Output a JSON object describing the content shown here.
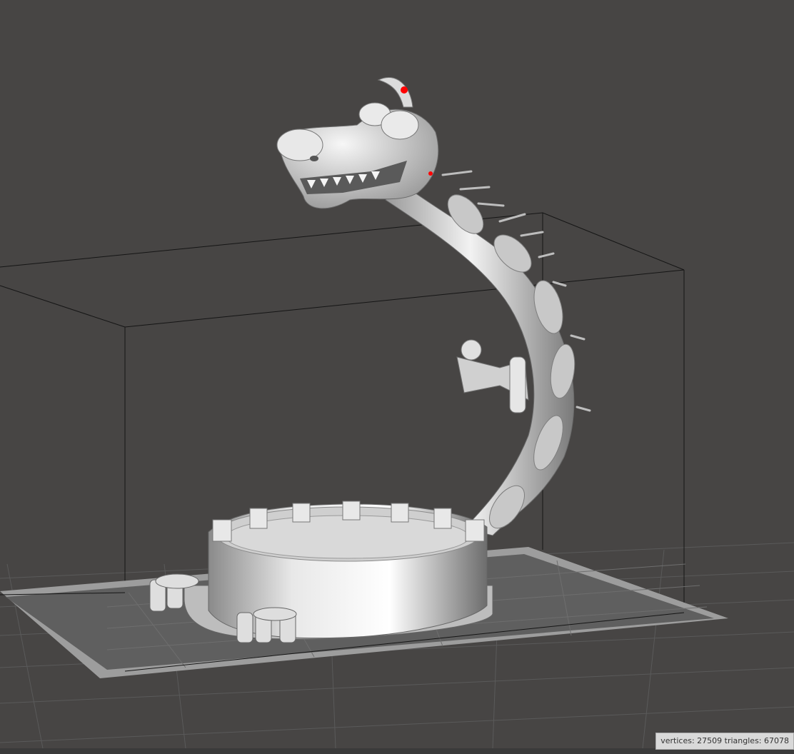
{
  "viewport": {
    "background_color": "#474544",
    "plate_color": "#9d9d9d",
    "model_color": "#d8d8d8",
    "bounding_box_color": "#1a1a1a",
    "grid_color": "#5a5a5a",
    "marker_color": "#ff0000"
  },
  "status": {
    "stats_text": "vertices: 27509 triangles: 67078"
  }
}
